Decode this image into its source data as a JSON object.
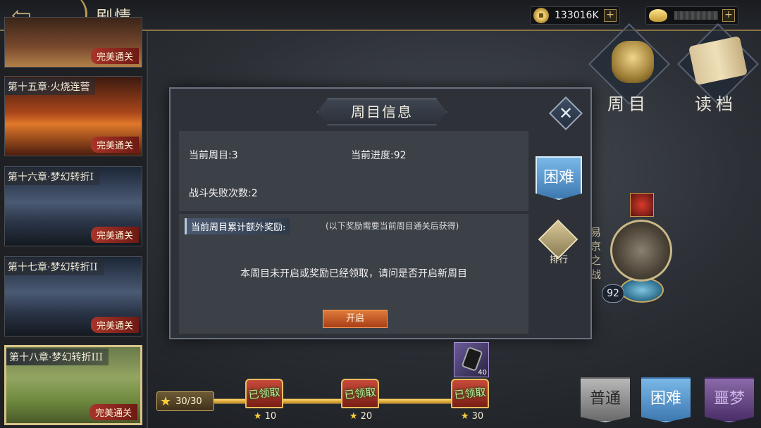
{
  "header": {
    "back_glyph": "⇦",
    "title": "剧情",
    "coins": "133016K",
    "plus": "+"
  },
  "chapters": [
    {
      "title": "",
      "badge": "完美通关"
    },
    {
      "title": "第十五章·火烧连营",
      "badge": "完美通关"
    },
    {
      "title": "第十六章·梦幻转折I",
      "badge": "完美通关"
    },
    {
      "title": "第十七章·梦幻转折II",
      "badge": "完美通关"
    },
    {
      "title": "第十八章·梦幻转折III",
      "badge": "完美通关"
    }
  ],
  "side": {
    "round_label": "周目",
    "load_label": "读档",
    "hard_label": "困难",
    "rank_label": "排行"
  },
  "level": {
    "name": "易京之战",
    "number": "92"
  },
  "modal": {
    "title": "周目信息",
    "close_glyph": "✕",
    "current_round": "当前周目:3",
    "current_progress": "当前进度:92",
    "battle_failures": "战斗失败次数:2",
    "reward_header": "当前周目累计额外奖励:",
    "reward_note": "(以下奖励需要当前周目通关后获得)",
    "reward_message": "本周目未开启或奖励已经领取，请问是否开启新周目",
    "open_button": "开启"
  },
  "progress": {
    "star_count": "30/30",
    "fraction": 1.0,
    "chests": [
      {
        "label": "已领取",
        "stars": "10"
      },
      {
        "label": "已领取",
        "stars": "20"
      },
      {
        "label": "已领取",
        "stars": "30"
      }
    ],
    "bonus_count": "40"
  },
  "difficulty": {
    "normal": "普通",
    "hard": "困难",
    "nightmare": "噩梦"
  },
  "colors": {
    "accent_gold": "#c8a860",
    "badge_red": "#a8342a",
    "hard_blue": "#3e78b0"
  }
}
